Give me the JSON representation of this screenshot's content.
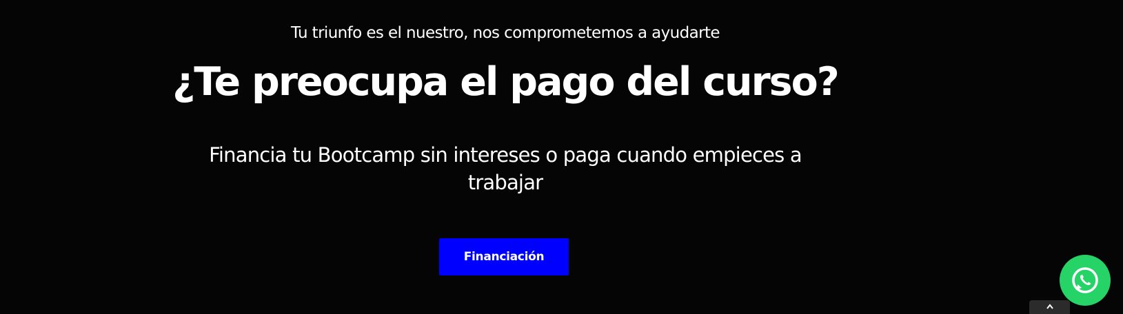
{
  "hero": {
    "eyebrow": "Tu triunfo es el nuestro, nos comprometemos a ayudarte",
    "headline": "¿Te preocupa el pago del curso?",
    "subhead": "Financia tu Bootcamp sin intereses o paga cuando empieces a trabajar",
    "cta_label": "Financiación"
  },
  "floating": {
    "whatsapp_icon": "whatsapp-icon",
    "scroll_top_icon": "chevron-up-icon"
  },
  "colors": {
    "background": "#050505",
    "cta": "#0000ff",
    "whatsapp": "#25d366"
  }
}
